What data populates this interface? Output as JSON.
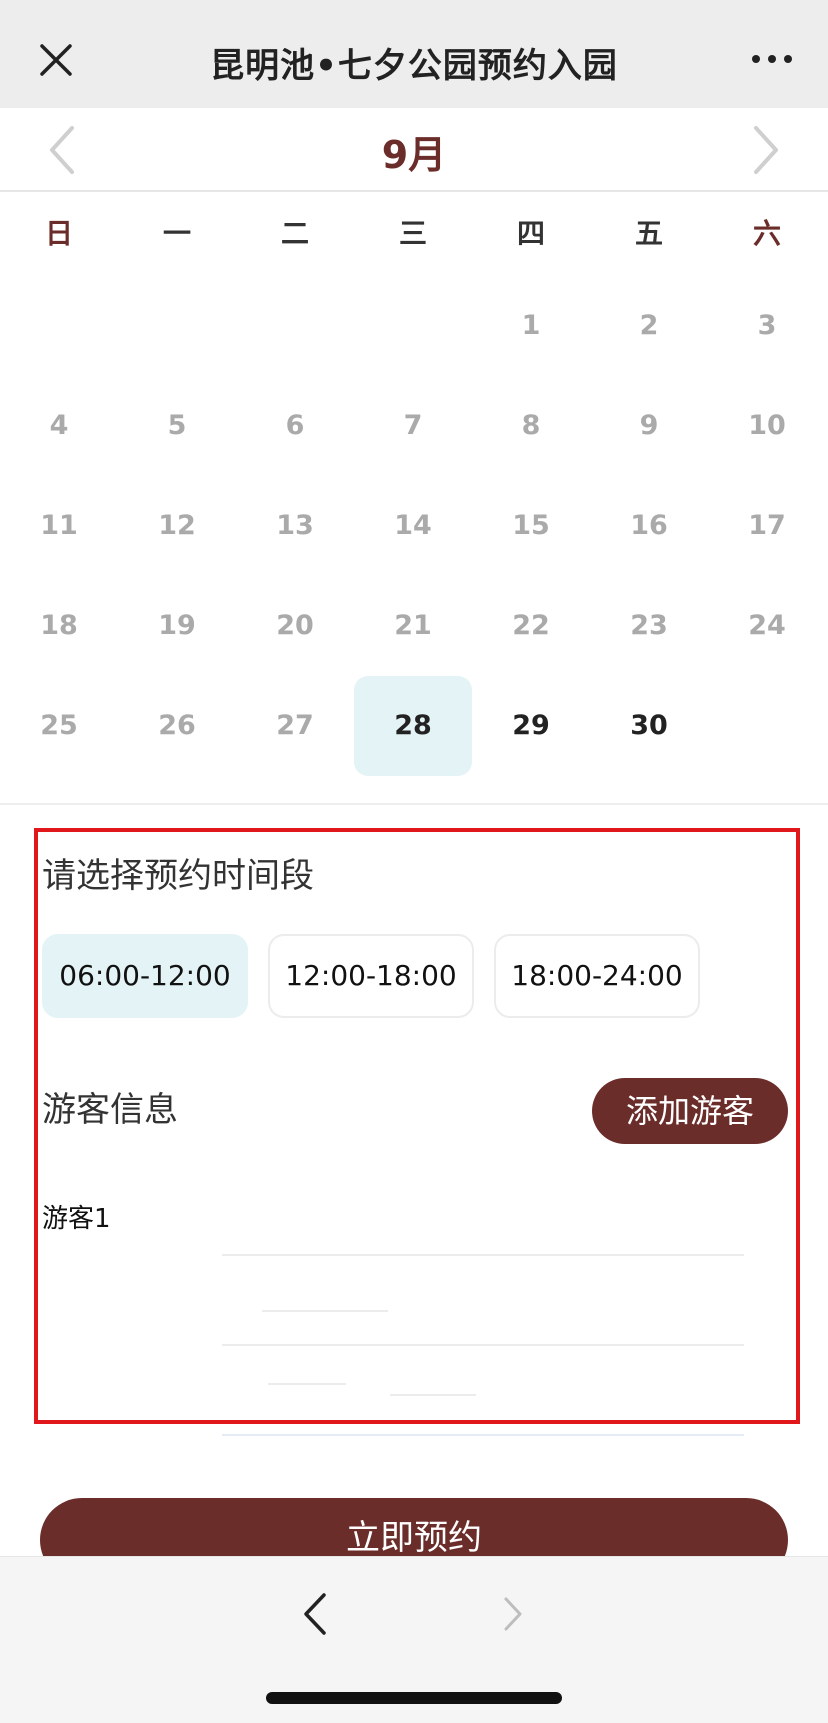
{
  "topbar": {
    "title": "昆明池•七夕公园预约入园",
    "close_icon": "close-icon",
    "more_icon": "more-icon"
  },
  "calendar": {
    "month_label": "9月",
    "weekdays": [
      "日",
      "一",
      "二",
      "三",
      "四",
      "五",
      "六"
    ],
    "weeks": [
      [
        "",
        "",
        "",
        "",
        "1",
        "2",
        "3"
      ],
      [
        "4",
        "5",
        "6",
        "7",
        "8",
        "9",
        "10"
      ],
      [
        "11",
        "12",
        "13",
        "14",
        "15",
        "16",
        "17"
      ],
      [
        "18",
        "19",
        "20",
        "21",
        "22",
        "23",
        "24"
      ],
      [
        "25",
        "26",
        "27",
        "28",
        "29",
        "30",
        ""
      ]
    ],
    "available_days": [
      "28",
      "29",
      "30"
    ],
    "selected_day": "28"
  },
  "booking": {
    "time_title": "请选择预约时间段",
    "slots": [
      "06:00-12:00",
      "12:00-18:00",
      "18:00-24:00"
    ],
    "selected_slot": "06:00-12:00",
    "visitor_title": "游客信息",
    "add_visitor_label": "添加游客",
    "visitor_1_label": "游客1",
    "submit_label": "立即预约"
  },
  "colors": {
    "accent": "#6b2d2a",
    "selected_bg": "#e4f3f6",
    "highlight_border": "#e0181b"
  }
}
